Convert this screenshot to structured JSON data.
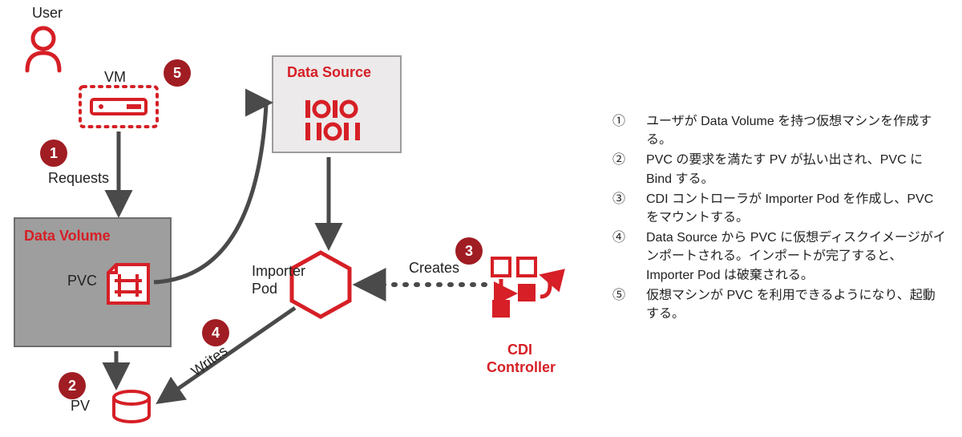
{
  "nodes": {
    "user": "User",
    "vm": "VM",
    "data_source": "Data Source",
    "data_volume": "Data Volume",
    "pvc": "PVC",
    "importer_pod_line1": "Importer",
    "importer_pod_line2": "Pod",
    "cdi_controller_line1": "CDI",
    "cdi_controller_line2": "Controller",
    "pv": "PV"
  },
  "edges": {
    "requests": "Requests",
    "creates": "Creates",
    "writes": "Writes"
  },
  "badges": {
    "b1": "1",
    "b2": "2",
    "b3": "3",
    "b4": "4",
    "b5": "5"
  },
  "legend": [
    {
      "num": "①",
      "text": "ユーザが Data Volume を持つ仮想マシンを作成する。"
    },
    {
      "num": "②",
      "text": "PVC の要求を満たす PV が払い出され、PVC に Bind する。"
    },
    {
      "num": "③",
      "text": "CDI コントローラが Importer Pod を作成し、PVC をマウントする。"
    },
    {
      "num": "④",
      "text": "Data Source から PVC に仮想ディスクイメージがインポートされる。インポートが完了すると、Importer Pod は破棄される。"
    },
    {
      "num": "⑤",
      "text": "仮想マシンが PVC を利用できるようになり、起動する。"
    }
  ]
}
